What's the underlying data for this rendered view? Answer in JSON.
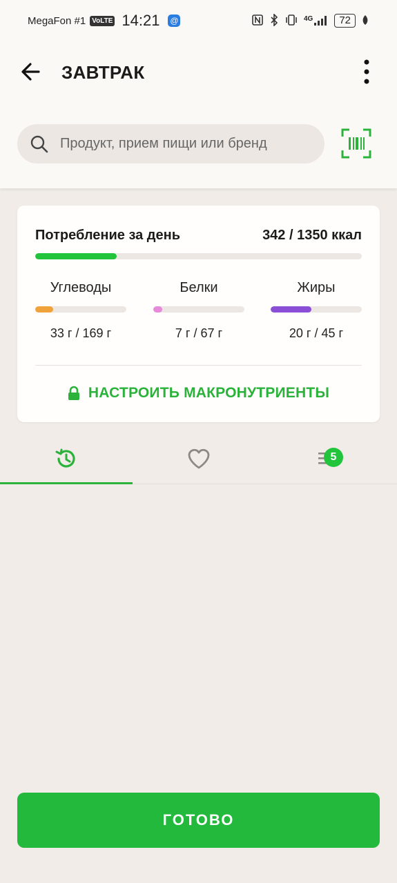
{
  "status_bar": {
    "carrier": "MegaFon #1",
    "volte": "VoLTE",
    "time": "14:21",
    "network": "4G",
    "battery": "72"
  },
  "header": {
    "title": "ЗАВТРАК"
  },
  "search": {
    "placeholder": "Продукт, прием пищи или бренд"
  },
  "summary": {
    "title": "Потребление за день",
    "total": "342 / 1350 ккал",
    "progress": 0.25,
    "macros": [
      {
        "label": "Углеводы",
        "value": "33 г / 169 г",
        "progress": 0.2,
        "color": "#f0a33a"
      },
      {
        "label": "Белки",
        "value": "7 г / 67 г",
        "progress": 0.1,
        "color": "#e78ad9"
      },
      {
        "label": "Жиры",
        "value": "20 г / 45 г",
        "progress": 0.45,
        "color": "#8a4fd6"
      }
    ],
    "macro_link": "НАСТРОИТЬ МАКРОНУТРИЕНТЫ"
  },
  "tabs": [
    {
      "icon": "history-icon",
      "active": true
    },
    {
      "icon": "heart-icon",
      "active": false
    },
    {
      "icon": "list-icon",
      "badge": "5",
      "active": false
    }
  ],
  "done_label": "ГОТОВО",
  "colors": {
    "accent": "#21c43a",
    "background": "#f1ece8"
  }
}
